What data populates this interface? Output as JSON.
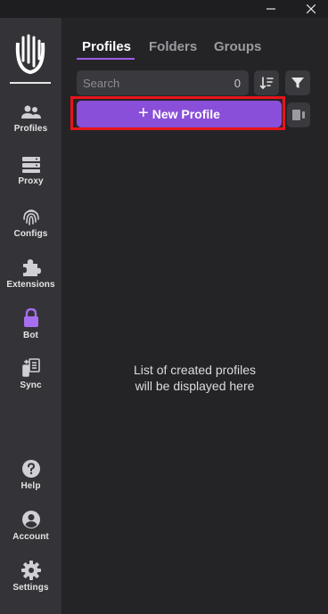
{
  "sidebar": {
    "items": [
      {
        "label": "Profiles",
        "icon": "users-icon"
      },
      {
        "label": "Proxy",
        "icon": "server-icon"
      },
      {
        "label": "Configs",
        "icon": "fingerprint-icon"
      },
      {
        "label": "Extensions",
        "icon": "puzzle-icon"
      },
      {
        "label": "Bot",
        "icon": "lock-icon"
      },
      {
        "label": "Sync",
        "icon": "sync-icon"
      }
    ],
    "bottom_items": [
      {
        "label": "Help",
        "icon": "help-icon"
      },
      {
        "label": "Account",
        "icon": "account-icon"
      },
      {
        "label": "Settings",
        "icon": "gear-icon"
      }
    ]
  },
  "tabs": [
    {
      "label": "Profiles",
      "active": true
    },
    {
      "label": "Folders",
      "active": false
    },
    {
      "label": "Groups",
      "active": false
    }
  ],
  "search": {
    "placeholder": "Search",
    "value": "",
    "count": "0"
  },
  "new_profile": {
    "label": "New Profile"
  },
  "empty_state": {
    "line1": "List of created profiles",
    "line2": "will be displayed here"
  },
  "colors": {
    "accent": "#8a4fd8",
    "highlight": "#e8141b",
    "background": "#242427",
    "sidebar": "#343438"
  }
}
